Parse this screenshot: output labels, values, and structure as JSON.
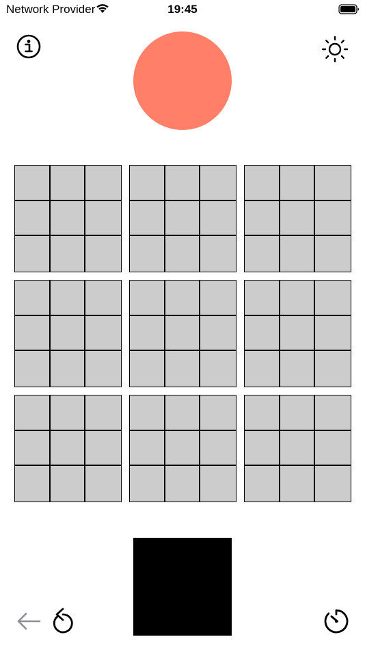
{
  "status_bar": {
    "carrier": "Network Provider",
    "time": "19:45",
    "wifi_icon": "wifi-icon",
    "battery_icon": "battery-icon"
  },
  "header": {
    "info_icon": "info-icon",
    "settings_icon": "sun-icon",
    "target_color": "#ff7f69"
  },
  "board": {
    "blocks": 9,
    "cells_per_block": 9,
    "cell_color": "#cccccc",
    "line_color": "#000000"
  },
  "footer": {
    "preview_color": "#000000",
    "back_icon": "arrow-left-icon",
    "undo_icon": "undo-icon",
    "timer_icon": "timer-icon"
  }
}
